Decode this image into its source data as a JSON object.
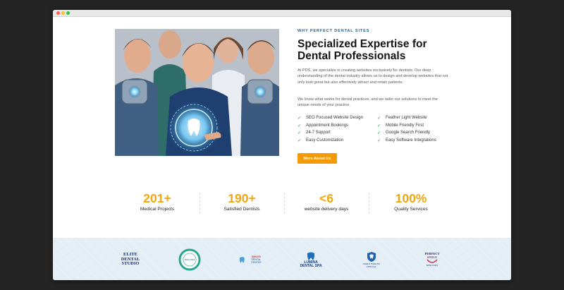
{
  "window": {
    "controls": [
      "close",
      "minimize",
      "maximize"
    ]
  },
  "hero": {
    "image_alt_icon": "dental-professionals-photo-icon"
  },
  "about": {
    "eyebrow": "WHY PERFECT DENTAL SITES",
    "headline_line1": "Specialized Expertise for",
    "headline_line2": "Dental Professionals",
    "paragraph1": "At PDS, we specialize in creating websites exclusively for dentists. Our deep understanding of the dental industry allows us to design and develop websites that not only look great but also effectively attract and retain patients.",
    "paragraph2": "We know what works for dental practices, and we tailor our solutions to meet the unique needs of your practice.",
    "features": [
      "SEO Focused Website Design",
      "Feather Light Website",
      "Appointment Bookings",
      "Mobile Friendly First",
      "24-7 Support",
      "Google Search Friendly",
      "Easy Customization",
      "Easy Software Integrations"
    ],
    "cta_label": "More About Us"
  },
  "stats": [
    {
      "value": "201+",
      "label": "Medical Projects"
    },
    {
      "value": "190+",
      "label": "Satisfied Dentists"
    },
    {
      "value": "<6",
      "label": "website delivery days"
    },
    {
      "value": "100%",
      "label": "Quality Services"
    }
  ],
  "logos": {
    "elite": {
      "line1": "ELITE",
      "line2": "DENTAL",
      "line3": "STUDIO"
    },
    "ring": {
      "text": "SMILE RING"
    },
    "smiles_center": {
      "line1": "SMILES",
      "line2": "DENTAL CENTER"
    },
    "lumina": {
      "line1": "LUMINA",
      "line2": "DENTAL SPA"
    },
    "smile_bright": {
      "line1": "SMILE BRIGHT",
      "line2": "DENTAL"
    },
    "perfect_smile": {
      "line1": "PERFECT",
      "line2": "SMILE",
      "line3": "DENTISTRY"
    }
  },
  "colors": {
    "accent": "#f59a07",
    "stat_number": "#f4a70c",
    "eyebrow": "#1e5f86",
    "check": "#2aa24f",
    "strip_bg": "#e4eef6"
  }
}
